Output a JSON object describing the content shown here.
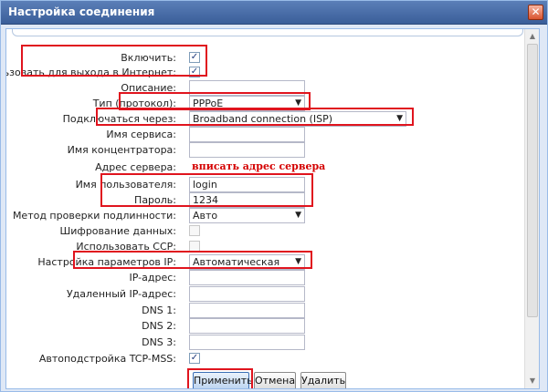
{
  "window": {
    "title": "Настройка соединения",
    "close_glyph": "✕"
  },
  "form": {
    "enable_label": "Включить:",
    "enable_checked": "✓",
    "internet_label": "Использовать для выхода в Интернет:",
    "internet_checked": "✓",
    "description_label": "Описание:",
    "description_value": "",
    "protocol_label": "Тип (протокол):",
    "protocol_value": "PPPoE",
    "connect_via_label": "Подключаться через:",
    "connect_via_value": "Broadband connection (ISP)",
    "service_label": "Имя сервиса:",
    "service_value": "",
    "concentrator_label": "Имя концентратора:",
    "concentrator_value": "",
    "server_label": "Адрес сервера:",
    "server_note": "вписать адрес сервера",
    "username_label": "Имя пользователя:",
    "username_value": "login",
    "password_label": "Пароль:",
    "password_value": "1234",
    "auth_label": "Метод проверки подлинности:",
    "auth_value": "Авто",
    "encryption_label": "Шифрование данных:",
    "ccp_label": "Использовать CCP:",
    "ip_settings_label": "Настройка параметров IP:",
    "ip_settings_value": "Автоматическая",
    "ip_label": "IP-адрес:",
    "remote_ip_label": "Удаленный IP-адрес:",
    "dns1_label": "DNS 1:",
    "dns2_label": "DNS 2:",
    "dns3_label": "DNS 3:",
    "tcpmss_label": "Автоподстройка TCP-MSS:",
    "tcpmss_checked": "✓",
    "dropdown_arrow": "▼"
  },
  "buttons": {
    "apply": "Применить",
    "cancel": "Отмена",
    "delete": "Удалить"
  },
  "colors": {
    "highlight": "#e0141e",
    "title_bg": "#3a5e99",
    "note": "#d40000"
  }
}
